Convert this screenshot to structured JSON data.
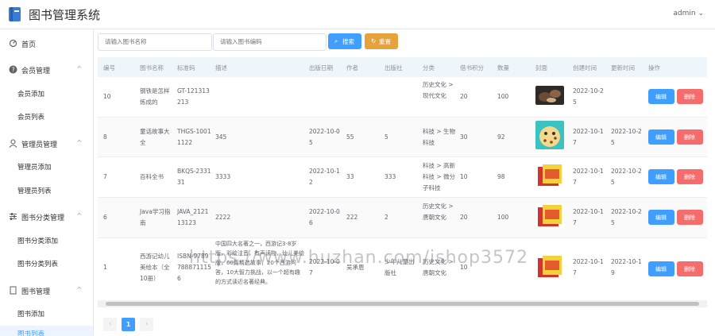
{
  "app": {
    "title": "图书管理系统",
    "user": "admin"
  },
  "sidebar": {
    "home": "首页",
    "sections": [
      {
        "label": "会员管理",
        "items": [
          "会员添加",
          "会员列表"
        ]
      },
      {
        "label": "管理员管理",
        "items": [
          "管理员添加",
          "管理员列表"
        ]
      },
      {
        "label": "图书分类管理",
        "items": [
          "图书分类添加",
          "图书分类列表"
        ]
      },
      {
        "label": "图书管理",
        "items": [
          "图书添加",
          "图书列表"
        ]
      }
    ]
  },
  "search": {
    "name_placeholder": "请输入图书名称",
    "code_placeholder": "请输入图书编码",
    "search_label": "搜索",
    "reset_label": "重置"
  },
  "table": {
    "headers": [
      "编号",
      "图书名称",
      "标准码",
      "描述",
      "出版日期",
      "作者",
      "出版社",
      "分类",
      "借书积分",
      "数量",
      "封面",
      "创建时间",
      "更新时间",
      "操作"
    ],
    "edit_label": "编辑",
    "delete_label": "删除",
    "rows": [
      {
        "id": "10",
        "name": "钢铁是怎样炼成的",
        "code": "GT-121313213",
        "desc": "",
        "pub_date": "",
        "author": "",
        "publisher": "",
        "category": "历史文化 > 现代文化",
        "points": "20",
        "qty": "100",
        "created": "2022-10-25",
        "updated": ""
      },
      {
        "id": "8",
        "name": "童话故事大全",
        "code": "THGS-10011122",
        "desc": "345",
        "pub_date": "2022-10-05",
        "author": "55",
        "publisher": "5",
        "category": "科技 > 生物科技",
        "points": "30",
        "qty": "92",
        "created": "2022-10-17",
        "updated": "2022-10-25"
      },
      {
        "id": "7",
        "name": "百科全书",
        "code": "BKQS-233131",
        "desc": "3333",
        "pub_date": "2022-10-12",
        "author": "33",
        "publisher": "333",
        "category": "科技 > 高新科技 > 微分子科技",
        "points": "10",
        "qty": "98",
        "created": "2022-10-17",
        "updated": "2022-10-25"
      },
      {
        "id": "6",
        "name": "Java学习指南",
        "code": "JAVA_212113123",
        "desc": "2222",
        "pub_date": "2022-10-06",
        "author": "222",
        "publisher": "2",
        "category": "历史文化 > 唐朝文化",
        "points": "20",
        "qty": "100",
        "created": "2022-10-17",
        "updated": "2022-10-25"
      },
      {
        "id": "1",
        "name": "西游记幼儿美绘本（全10册）",
        "code": "ISBN-97897888711156",
        "desc": "中国四大名著之一，西游记3-8岁版，彩绘注音，有声读物，幼儿美绘版，60篇精选故事，20个西游问答，10大智力挑战，以一个超有趣的方式读近名著经典。",
        "pub_date": "2022-10-07",
        "author": "吴承恩",
        "publisher": "少年儿童出版社",
        "category": "历史文化 > 唐朝文化",
        "points": "10",
        "qty": "",
        "created": "2022-10-17",
        "updated": "2022-10-19"
      }
    ]
  },
  "pagination": {
    "current": "1",
    "prev": "‹",
    "next": "›"
  },
  "watermark": "https://www.huzhan.com/ishop3572",
  "colors": {
    "primary": "#409eff",
    "warning": "#e6a23c",
    "danger": "#f56c6c"
  }
}
